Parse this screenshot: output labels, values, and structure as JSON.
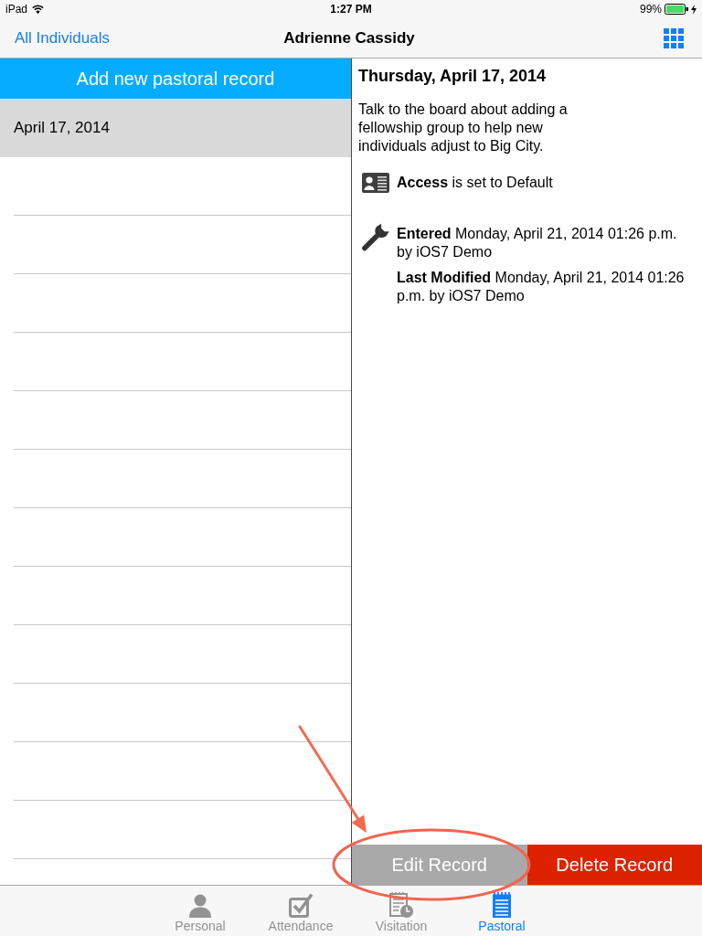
{
  "status_bar": {
    "device": "iPad",
    "time": "1:27 PM",
    "battery": "99%"
  },
  "nav_bar": {
    "back": "All Individuals",
    "title": "Adrienne Cassidy"
  },
  "sidebar": {
    "add_button": "Add new pastoral record",
    "records": [
      {
        "date": "April 17, 2014",
        "selected": true
      }
    ]
  },
  "detail": {
    "heading": "Thursday, April 17, 2014",
    "note": "Talk to the board about adding a fellowship group to help new individuals adjust to Big City.",
    "access": "**Access** is set to Default",
    "entered": "**Entered** Monday, April 21, 2014 01:26 p.m. by iOS7 Demo",
    "modified": "**Last Modified** Monday, April 21, 2014 01:26 p.m. by iOS7 Demo"
  },
  "actions": [
    {
      "label": "Edit Record",
      "kind": "edit"
    },
    {
      "label": "Delete Record",
      "kind": "delete"
    }
  ],
  "tab_bar": [
    {
      "label": "Personal",
      "selected": false
    },
    {
      "label": "Attendance",
      "selected": false
    },
    {
      "label": "Visitation",
      "selected": false
    },
    {
      "label": "Pastoral",
      "selected": true
    }
  ]
}
